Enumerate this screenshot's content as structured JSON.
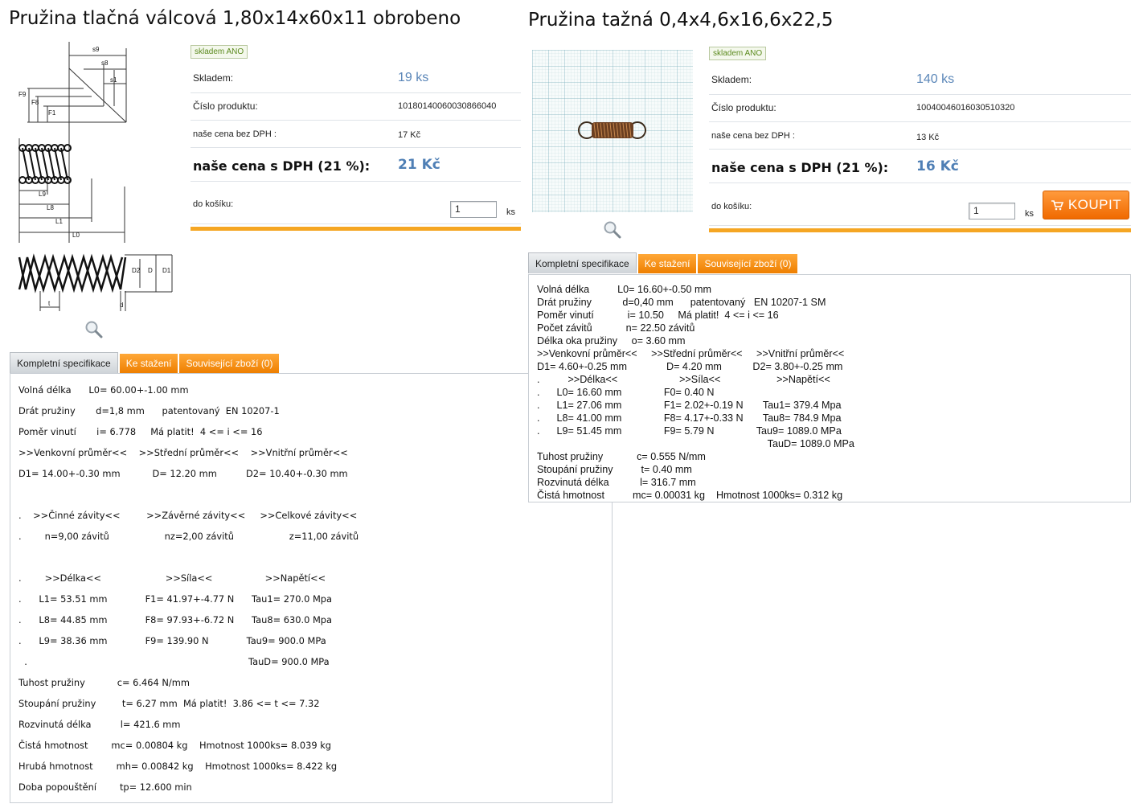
{
  "left": {
    "title": "Pružina tlačná válcová 1,80x14x60x11 obrobeno",
    "badge": "skladem ANO",
    "stock_label": "Skladem:",
    "stock_value": "19 ks",
    "product_no_label": "Číslo produktu:",
    "product_no_value": "10180140060030866040",
    "price_net_label": "naše cena bez DPH :",
    "price_net_value": "17 Kč",
    "price_vat_label": "naše cena s DPH (21 %):",
    "price_vat_value": "21 Kč",
    "cart_label": "do košíku:",
    "qty_value": "1",
    "qty_unit": "ks",
    "drawing_labels": [
      "s9",
      "s8",
      "s1",
      "F9",
      "F8",
      "F1",
      "L9",
      "L8",
      "L1",
      "L0",
      "D2",
      "D",
      "D1",
      "t",
      "d"
    ],
    "tabs": [
      "Kompletní specifikace",
      "Ke stažení",
      "Související zboží (0)"
    ],
    "spec": [
      "Volná délka      L0= 60.00+-1.00 mm",
      "Drát pružiny       d=1,8 mm      patentovaný  EN 10207-1",
      "Poměr vinutí       i= 6.778     Má platit!  4 <= i <= 16",
      ">>Venkovní průměr<<    >>Střední průměr<<    >>Vnitřní průměr<<",
      "D1= 14.00+-0.30 mm           D= 12.20 mm          D2= 10.40+-0.30 mm",
      "",
      ".    >>Činné závity<<         >>Závěrné závity<<     >>Celkové závity<<",
      ".        n=9,00 závitů                   nz=2,00 závitů                   z=11,00 závitů",
      "",
      ".        >>Délka<<                      >>Síla<<                  >>Napětí<<",
      ".      L1= 53.51 mm             F1= 41.97+-4.77 N      Tau1= 270.0 Mpa",
      ".      L8= 44.85 mm             F8= 97.93+-6.72 N      Tau8= 630.0 Mpa",
      ".      L9= 38.36 mm             F9= 139.90 N             Tau9= 900.0 MPa",
      "  .                                                                            TauD= 900.0 MPa",
      "Tuhost pružiny           c= 6.464 N/mm",
      "Stoupání pružiny         t= 6.27 mm  Má platit!  3.86 <= t <= 7.32",
      "Rozvinutá délka          l= 421.6 mm",
      "Čistá hmotnost        mc= 0.00804 kg    Hmotnost 1000ks= 8.039 kg",
      "Hrubá hmotnost        mh= 0.00842 kg    Hmotnost 1000ks= 8.422 kg",
      "Doba popouštění        tp= 12.600 min"
    ]
  },
  "right": {
    "title": "Pružina tažná 0,4x4,6x16,6x22,5",
    "badge": "skladem ANO",
    "stock_label": "Skladem:",
    "stock_value": "140 ks",
    "product_no_label": "Číslo produktu:",
    "product_no_value": "10040046016030510320",
    "price_net_label": "naše cena bez DPH :",
    "price_net_value": "13 Kč",
    "price_vat_label": "naše cena s DPH (21 %):",
    "price_vat_value": "16 Kč",
    "cart_label": "do košíku:",
    "qty_value": "1",
    "qty_unit": "ks",
    "buy_label": "KOUPIT",
    "tabs": [
      "Kompletní specifikace",
      "Ke stažení",
      "Související zboží (0)"
    ],
    "spec": [
      "Volná délka          L0= 16.60+-0.50 mm",
      "Drát pružiny           d=0,40 mm      patentovaný   EN 10207-1 SM",
      "Poměr vinutí            i= 10.50     Má platit!  4 <= i <= 16",
      "Počet závitů            n= 22.50 závitů",
      "Délka oka pružiny     o= 3.60 mm",
      ">>Venkovní průměr<<     >>Střední průměr<<     >>Vnitřní průměr<<",
      "D1= 4.60+-0.25 mm              D= 4.20 mm           D2= 3.80+-0.25 mm",
      ".          >>Délka<<                      >>Síla<<                    >>Napětí<<",
      ".      L0= 16.60 mm               F0= 0.40 N",
      ".      L1= 27.06 mm               F1= 2.02+-0.19 N       Tau1= 379.4 Mpa",
      ".      L8= 41.00 mm               F8= 4.17+-0.33 N       Tau8= 784.9 Mpa",
      ".      L9= 51.45 mm               F9= 5.79 N               Tau9= 1089.0 MPa",
      "                                                                                  TauD= 1089.0 MPa",
      ".",
      "Tuhost pružiny            c= 0.555 N/mm",
      "Stoupání pružiny          t= 0.40 mm",
      "Rozvinutá délka           l= 316.7 mm",
      "Čistá hmotnost          mc= 0.00031 kg    Hmotnost 1000ks= 0.312 kg"
    ]
  }
}
